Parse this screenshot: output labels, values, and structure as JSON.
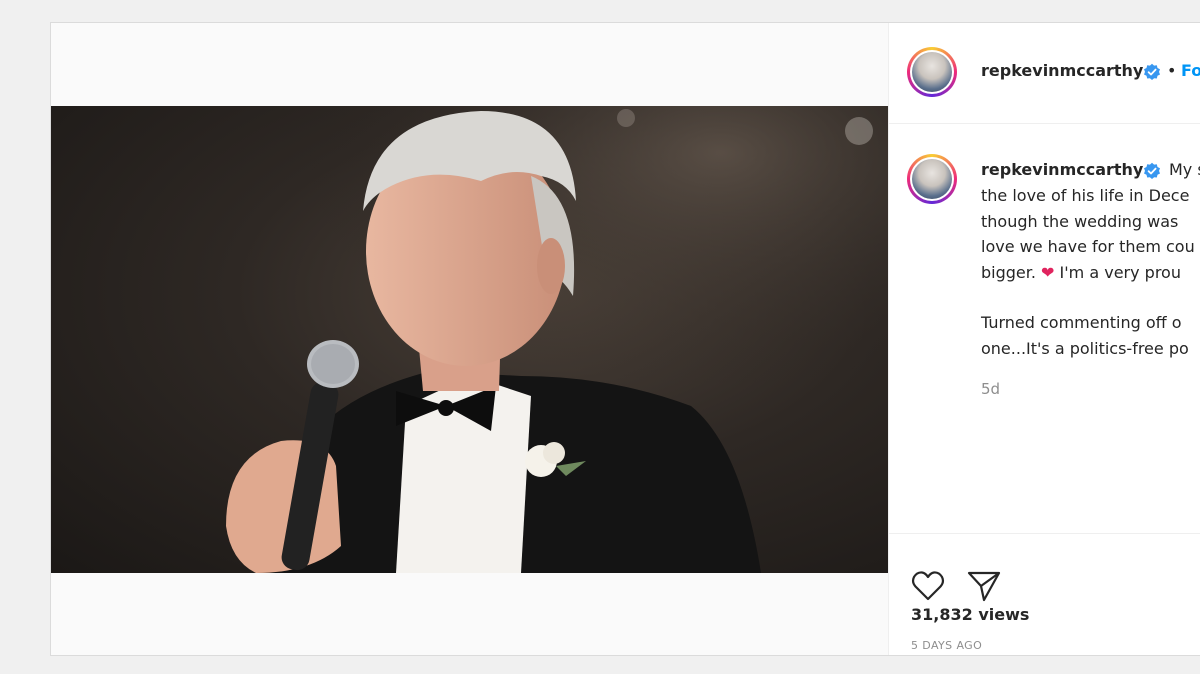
{
  "post": {
    "header": {
      "username": "repkevinmccarthy",
      "separator": "•",
      "follow_label": "Fo"
    },
    "caption": {
      "username": "repkevinmccarthy",
      "lines": [
        "My s",
        "the love of his life in Dece",
        "though the wedding was",
        "love we have for them cou",
        "bigger.",
        "I'm a very prou",
        "Turned commenting off o",
        "one...It's a politics-free po"
      ],
      "relative_time": "5d"
    },
    "actions": {
      "like_icon": "heart-icon",
      "share_icon": "share-icon",
      "views": "31,832 views",
      "date": "5 DAYS AGO"
    },
    "colors": {
      "verified": "#3897f0",
      "link": "#0095f6",
      "heart_emoji": "#e0245e"
    }
  }
}
